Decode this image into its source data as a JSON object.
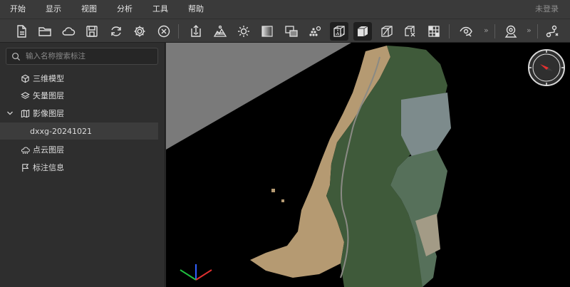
{
  "menu": {
    "items": [
      "开始",
      "显示",
      "视图",
      "分析",
      "工具",
      "帮助"
    ],
    "login": "未登录"
  },
  "toolbar": {
    "buttons": [
      "new-file-icon",
      "open-folder-icon",
      "cloud-icon",
      "save-icon",
      "refresh-icon",
      "settings-icon",
      "close-circle-icon",
      "import-icon",
      "terrain-icon",
      "sun-icon",
      "gradient-icon",
      "layer-compare-icon",
      "point-cloud-icon",
      "wireframe-cube-icon",
      "solid-cube-icon",
      "clip-cube-icon",
      "delete-cube-icon",
      "grid-icon",
      "eye-icon",
      "location-pin-icon",
      "route-icon"
    ],
    "more": "»"
  },
  "sidebar": {
    "search_placeholder": "输入名称搜索标注",
    "items": [
      {
        "label": "三维模型",
        "icon": "cube-icon"
      },
      {
        "label": "矢量图层",
        "icon": "layers-icon"
      },
      {
        "label": "影像图层",
        "icon": "map-icon",
        "expanded": true
      },
      {
        "label": "dxxg-20241021",
        "selected": true
      },
      {
        "label": "点云图层",
        "icon": "cloud-points-icon"
      },
      {
        "label": "标注信息",
        "icon": "flag-icon"
      }
    ]
  },
  "viewport": {
    "background": "#7a7a7a",
    "plane_color": "#000000"
  }
}
